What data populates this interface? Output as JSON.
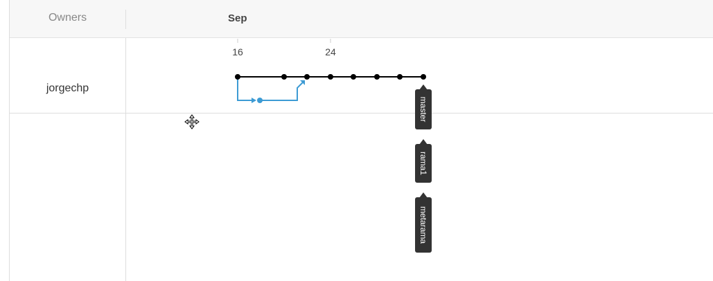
{
  "header": {
    "owners_label": "Owners",
    "month_label": "Sep"
  },
  "timeline": {
    "ticks": [
      "16",
      "24"
    ]
  },
  "owners": [
    {
      "name": "jorgechp"
    }
  ],
  "branches": [
    {
      "label": "master"
    },
    {
      "label": "rama1"
    },
    {
      "label": "metarama"
    }
  ],
  "colors": {
    "main_line": "#000000",
    "branch_line": "#3d9bd4",
    "tag_background": "#333333",
    "tag_text": "#ffffff"
  },
  "icons": {
    "cursor": "move-cursor-icon"
  }
}
